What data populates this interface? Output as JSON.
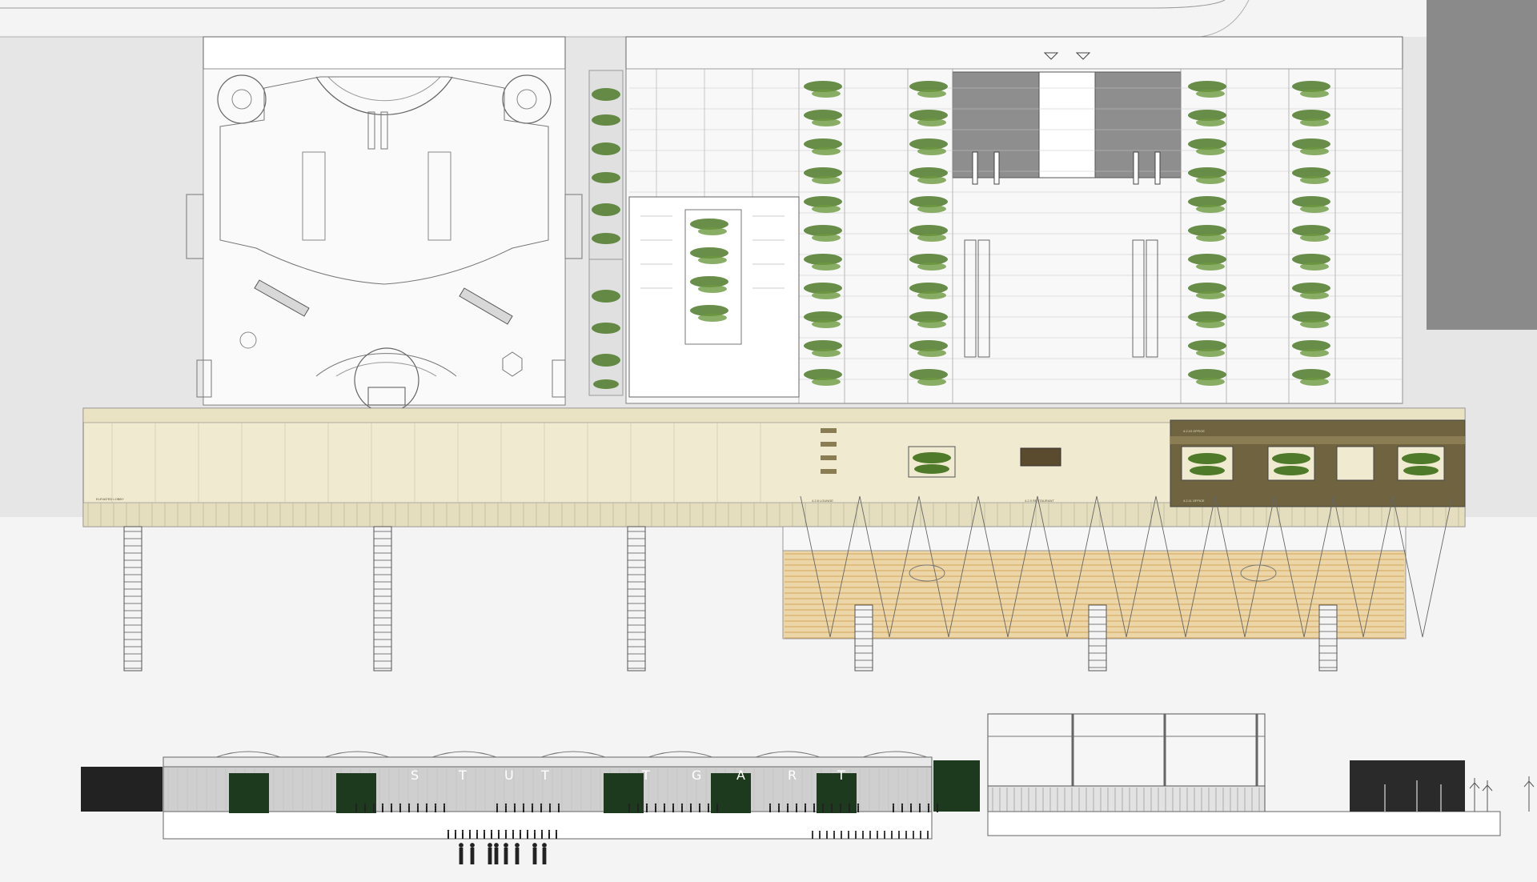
{
  "plan": {
    "labels": {
      "lobby": "ELEVATED LOBBY",
      "lounge": "4.2.8 LOUNGE",
      "restaurant": "4.2.9 RESTAURANT",
      "office_top": "4.2.10 OFFICE",
      "office_bottom": "4.2.11 OFFICE"
    }
  },
  "section": {
    "letters": [
      "S",
      "T",
      "U",
      "T",
      "T",
      "G",
      "A",
      "R",
      "T"
    ]
  },
  "colors": {
    "background": "#f4f4f4",
    "site_gray": "#e3e3e3",
    "dark_block": "#8e8e8e",
    "cream_floor": "#f0ead0",
    "olive_band": "#6f6340",
    "foliage": "#4f7a2a",
    "wood_canopy": "#e8c98e",
    "dark_green_panel": "#1e3a1e",
    "ink": "#555555"
  }
}
